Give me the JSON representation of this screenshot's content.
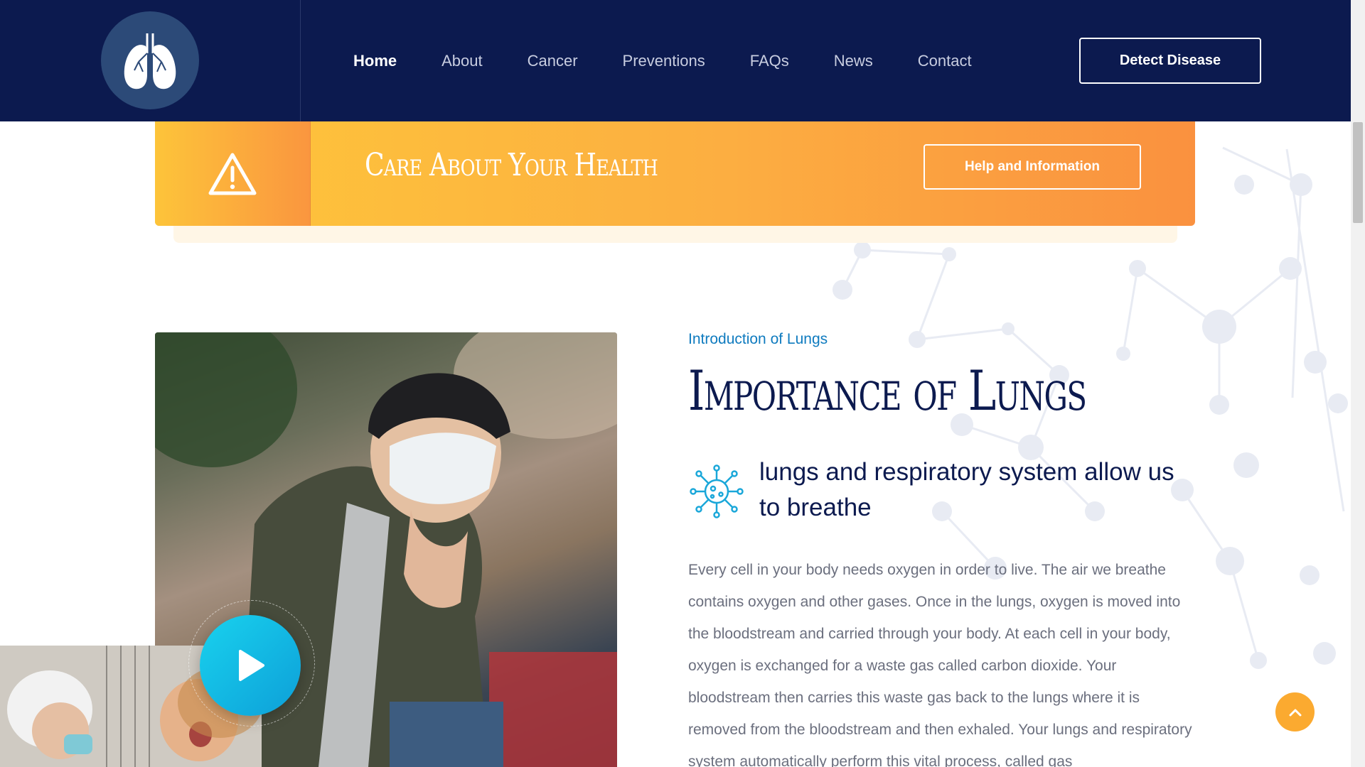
{
  "header": {
    "logo_icon": "lungs-icon",
    "nav": [
      {
        "label": "Home",
        "active": true
      },
      {
        "label": "About"
      },
      {
        "label": "Cancer"
      },
      {
        "label": "Preventions"
      },
      {
        "label": "FAQs"
      },
      {
        "label": "News"
      },
      {
        "label": "Contact"
      }
    ],
    "cta_label": "Detect Disease"
  },
  "banner": {
    "icon": "warning-icon",
    "title": "Care About Your Health",
    "button_label": "Help and Information"
  },
  "intro": {
    "kicker": "Introduction of Lungs",
    "heading": "Importance of Lungs",
    "feature_icon": "virus-icon",
    "feature_text": "lungs and respiratory system allow us to breathe",
    "body": "Every cell in your body needs oxygen in order to live. The air we breathe contains oxygen and other gases. Once in the lungs, oxygen is moved into the bloodstream and carried through your body. At each cell in your body, oxygen is exchanged for a waste gas called carbon dioxide. Your bloodstream then carries this waste gas back to the lungs where it is removed from the bloodstream and then exhaled. Your lungs and respiratory system automatically perform this vital process, called gas"
  },
  "media": {
    "main_photo": "person-coughing-photo",
    "thumb_photo": "child-doctor-photo",
    "play_icon": "play-icon"
  },
  "scroll_top_icon": "chevron-up-icon",
  "colors": {
    "header_bg": "#0c1a4f",
    "banner_start": "#fec73a",
    "banner_end": "#fa913f",
    "accent_blue": "#0f7bbf",
    "play_cyan": "#19d2ee",
    "to_top": "#fbaa30"
  }
}
